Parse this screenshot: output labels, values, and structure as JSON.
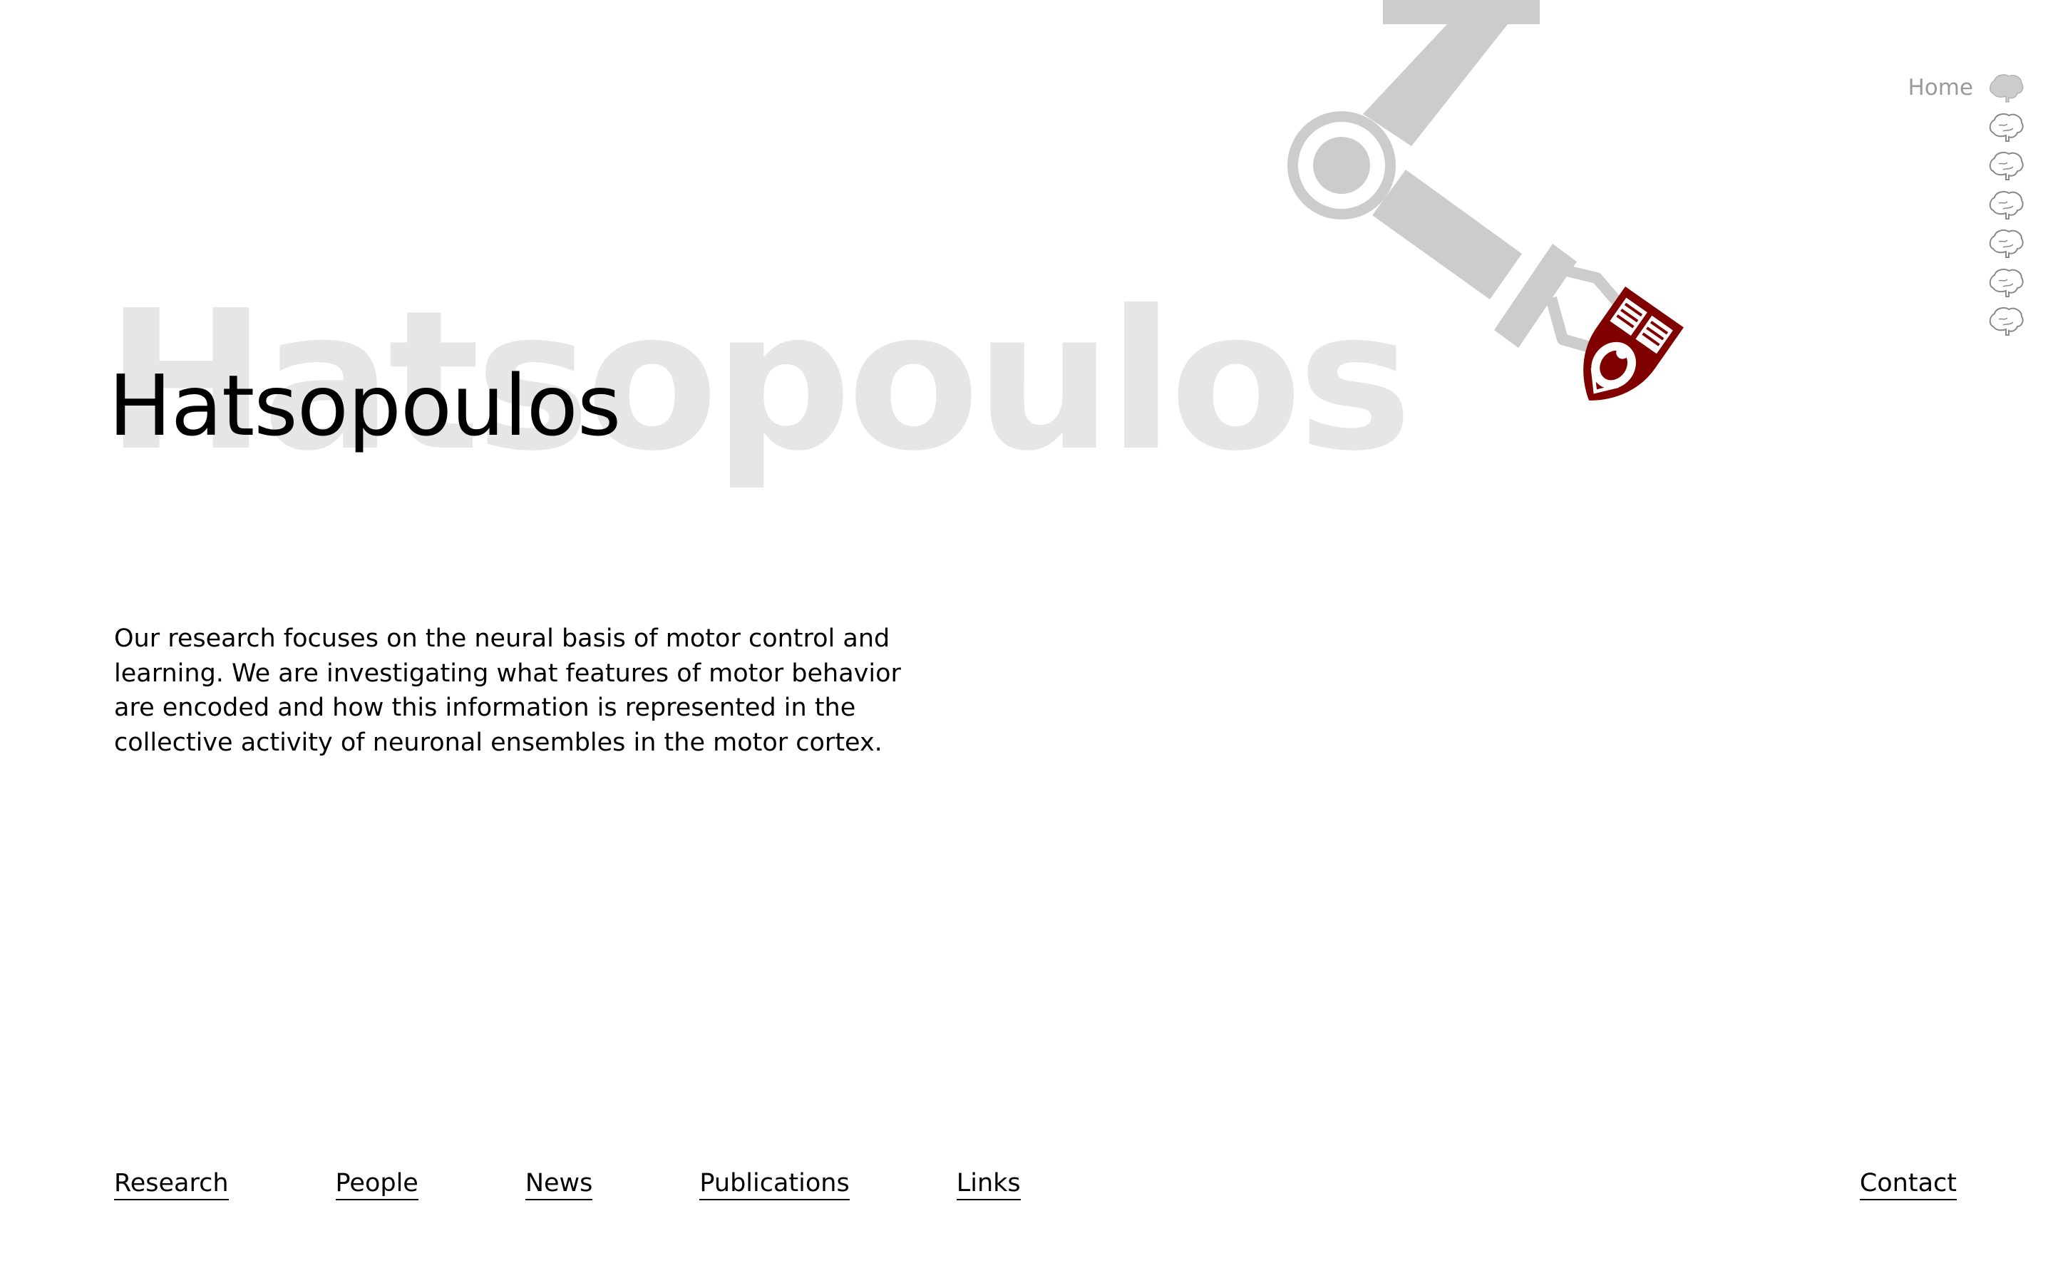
{
  "hero": {
    "background_title": "Hatsopoulos",
    "title": "Hatsopoulos",
    "intro": "Our research focuses on the neural basis of motor control and learning. We are investigating what features of motor behavior are encoded and how this information is represented in the collective activity of neuronal ensembles in the motor cortex."
  },
  "side_nav": {
    "items": [
      {
        "label": "Home",
        "icon": "brain-icon",
        "active": true
      },
      {
        "label": "",
        "icon": "brain-icon",
        "active": false
      },
      {
        "label": "",
        "icon": "brain-icon",
        "active": false
      },
      {
        "label": "",
        "icon": "brain-icon",
        "active": false
      },
      {
        "label": "",
        "icon": "brain-icon",
        "active": false
      },
      {
        "label": "",
        "icon": "brain-icon",
        "active": false
      },
      {
        "label": "",
        "icon": "brain-icon",
        "active": false
      }
    ]
  },
  "bottom_nav": {
    "items": [
      {
        "label": "Research"
      },
      {
        "label": "People"
      },
      {
        "label": "News"
      },
      {
        "label": "Publications"
      },
      {
        "label": "Links"
      }
    ],
    "contact": "Contact"
  },
  "illustration": {
    "arm_icon": "robot-arm-icon",
    "crest_icon": "university-crest-icon"
  },
  "colors": {
    "arm_gray": "#cccccc",
    "crest_maroon": "#800000",
    "background_title": "#e6e6e6",
    "muted_text": "#9a9a9a"
  }
}
